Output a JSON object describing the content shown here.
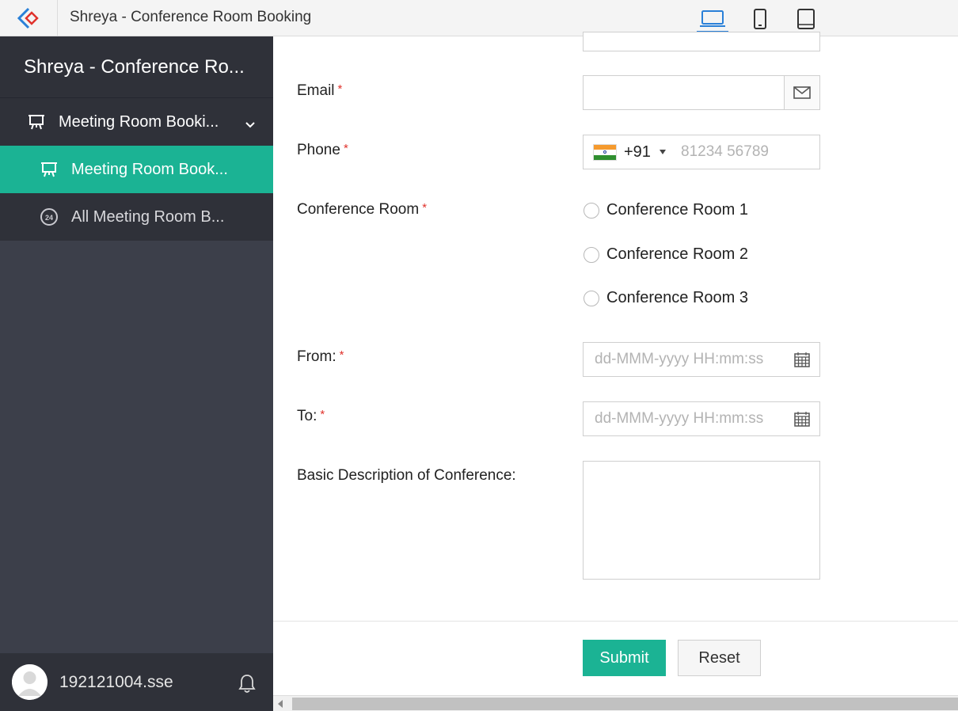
{
  "app": {
    "title": "Shreya - Conference Room Booking",
    "devices": [
      "laptop-icon",
      "phone-icon",
      "tablet-icon"
    ],
    "active_device": "laptop-icon"
  },
  "sidebar": {
    "header": "Shreya - Conference Ro...",
    "group": {
      "label": "Meeting Room Booki...",
      "icon": "presentation-icon"
    },
    "items": [
      {
        "label": "Meeting Room Book...",
        "icon": "presentation-icon",
        "active": true
      },
      {
        "label": "All Meeting Room B...",
        "icon": "clock-24-icon",
        "active": false
      }
    ],
    "user": "192121004.sse"
  },
  "form": {
    "email_label": "Email",
    "phone_label": "Phone",
    "phone_code": "+91",
    "phone_placeholder": "81234 56789",
    "room_label": "Conference Room",
    "rooms": [
      "Conference Room 1",
      "Conference Room 2",
      "Conference Room 3"
    ],
    "from_label": "From:",
    "to_label": "To:",
    "date_placeholder": "dd-MMM-yyyy HH:mm:ss",
    "desc_label": "Basic Description of Conference:",
    "required_mark": "*",
    "submit": "Submit",
    "reset": "Reset"
  },
  "colors": {
    "accent": "#1bb394",
    "sidebar": "#3c3f4a",
    "required": "#e0322c"
  }
}
